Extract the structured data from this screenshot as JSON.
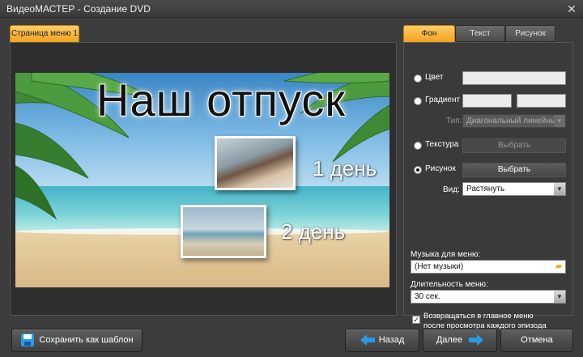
{
  "window": {
    "title": "ВидеоМАСТЕР - Создание DVD",
    "close_glyph": "✕"
  },
  "left_tab": {
    "label": "Страница меню 1"
  },
  "preview": {
    "menu_title": "Наш отпуск",
    "chapters": [
      {
        "label": "1 день"
      },
      {
        "label": "2 день"
      }
    ]
  },
  "right_tabs": [
    {
      "label": "Фон",
      "active": true
    },
    {
      "label": "Текст"
    },
    {
      "label": "Рисунок"
    }
  ],
  "background": {
    "options": [
      {
        "label": "Цвет",
        "selected": false
      },
      {
        "label": "Градиент",
        "selected": false
      },
      {
        "label": "Текстура",
        "selected": false
      },
      {
        "label": "Рисунок",
        "selected": true
      }
    ],
    "gradient_type_label": "Тип:",
    "gradient_type_value": "Диагональный линейный гр",
    "texture_choose_label": "Выбрать",
    "image_choose_label": "Выбрать",
    "view_label": "Вид:",
    "view_value": "Растянуть"
  },
  "music": {
    "label": "Музыка для меню:",
    "value": "(Нет музыки)"
  },
  "duration": {
    "label": "Длительность меню:",
    "value": "30 сек."
  },
  "return_checkbox": {
    "checked": true,
    "line1": "Возвращаться в главное меню",
    "line2": "после просмотра каждого эпизода",
    "check_glyph": "✓"
  },
  "buttons": {
    "save_template": "Сохранить как шаблон",
    "back": "Назад",
    "next": "Далее",
    "cancel": "Отмена"
  },
  "colors": {
    "accent": "#f3a21d",
    "arrow_blue": "#2a9ae6"
  },
  "icons": {
    "save": "floppy-disk-icon",
    "back": "arrow-left-icon",
    "next": "arrow-right-icon",
    "folder": "folder-icon",
    "dropdown": "chevron-down-icon"
  }
}
